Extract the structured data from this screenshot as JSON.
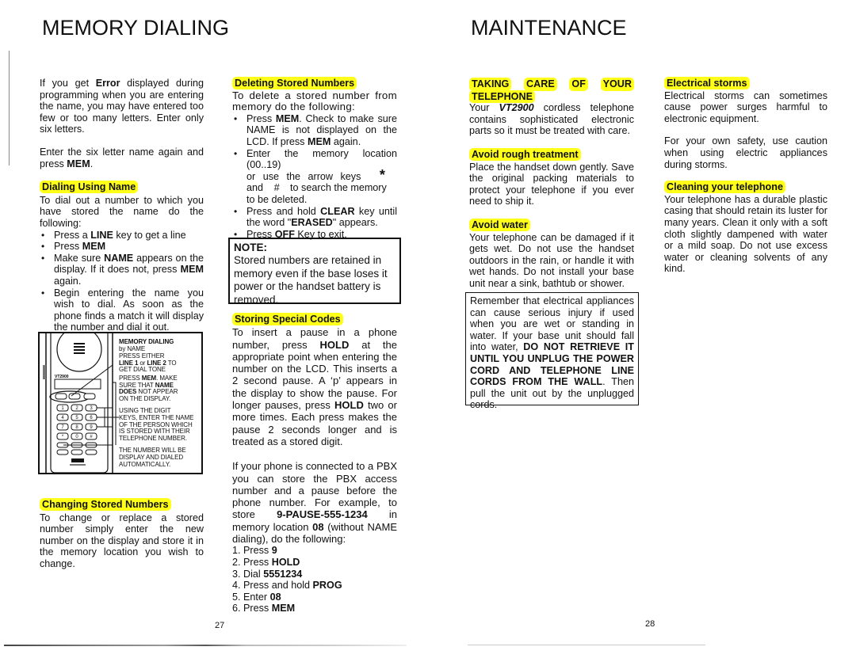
{
  "left_page": {
    "title": "MEMORY DIALING",
    "page_number": "27",
    "intro": {
      "p1_before": "If you get ",
      "p1_bold": "Error",
      "p1_after": " displayed during programming when you are entering the name, you may have entered  too few or too many letters.  Enter only six letters.",
      "p2_before": "Enter the six letter name again and press ",
      "p2_bold": "MEM",
      "p2_after": "."
    },
    "dialing_using_name": {
      "heading": "Dialing Using Name",
      "intro": "To dial out a number to which you have stored the name do the following:",
      "bullets": [
        {
          "before": "Press a ",
          "bold": "LINE",
          "after": " key to get a line"
        },
        {
          "before": "Press ",
          "bold": "MEM",
          "after": ""
        },
        {
          "before": "Make sure ",
          "bold": "NAME",
          "after": " appears on the display.  If it does not, press ",
          "bold2": "MEM",
          "after2": " again."
        },
        {
          "before": "Begin entering the name you wish to dial.  As soon as the phone finds a match it will display the number and dial it out.",
          "bold": "",
          "after": ""
        }
      ]
    },
    "figure": {
      "title": "MEMORY DIALING",
      "subtitle": "by NAME",
      "step1_a": "PRESS EITHER",
      "step1_b_bold1": "LINE 1",
      "step1_b_mid": " or ",
      "step1_b_bold2": "LINE 2",
      "step1_b_end": " TO",
      "step1_c": "GET DIAL TONE",
      "step2_a_pre": "PRESS ",
      "step2_a_bold": "MEM",
      "step2_a_post": ".  MAKE",
      "step2_b_pre": "SURE THAT ",
      "step2_b_bold": "NAME",
      "step2_c_bold": "DOES",
      "step2_c_post": " NOT APPEAR",
      "step2_d": "ON THE DISPLAY.",
      "step3_lines": [
        "USING THE DIGIT",
        "KEYS, ENTER THE NAME",
        "OF THE PERSON WHICH",
        "IS STORED WITH THEIR",
        "TELEPHONE NUMBER."
      ],
      "step4_lines": [
        "THE NUMBER WILL BE",
        "DISPLAY AND DIALED",
        "AUTOMATICALLY."
      ],
      "handset_model": "VT2900",
      "keypad": [
        "1",
        "2",
        "3",
        "4",
        "5",
        "6",
        "7",
        "8",
        "9",
        "*",
        "0",
        "#"
      ]
    },
    "changing_stored_numbers": {
      "heading": "Changing Stored Numbers",
      "body": "To change or replace a stored number simply enter the new number on the display and store it in the memory location you wish to change."
    },
    "deleting_stored_numbers": {
      "heading": "Deleting Stored Numbers",
      "intro": "To delete a stored number from memory do the following:",
      "b1_pre": "Press ",
      "b1_bold1": "MEM",
      "b1_mid": ". Check to make sure NAME is not displayed on the LCD. If press ",
      "b1_bold2": "MEM",
      "b1_post": " again.",
      "b2_line1": "Enter the memory location (00..19)",
      "b2_line2_pre": "or use the arrow keys",
      "b2_star": "*",
      "b2_line3_pre": "and",
      "b2_hash": "#",
      "b2_line3_post": "to search the memory",
      "b2_line4": "to be deleted.",
      "b3_pre": "Press and hold ",
      "b3_bold": "CLEAR",
      "b3_mid": " key until the word \"",
      "b3_bold2": "ERASED",
      "b3_post": "\" appears.",
      "b4_pre": "Press ",
      "b4_bold": "OFF",
      "b4_post": " Key to exit."
    },
    "note": {
      "label": "NOTE:",
      "body": "Stored numbers are retained in memory even if the base loses it power or the handset battery is removed."
    },
    "storing_special_codes": {
      "heading": "Storing Special Codes",
      "p1_a": "To insert a pause in a phone number, press ",
      "p1_bold1": "HOLD",
      "p1_b": " at the appropriate point when entering the number on the LCD. This inserts a 2 second pause. A ‘p’ appears in the display to show the pause.  For longer pauses, press ",
      "p1_bold2": "HOLD",
      "p1_c": " two or more times.  Each press makes the pause 2 seconds longer and is treated as a stored digit.",
      "p2_a": "If your phone is connected to a PBX you can store the PBX access number and a pause before the phone number. For example, to store ",
      "p2_bold1": "9-PAUSE-555-1234",
      "p2_b": " in memory location ",
      "p2_bold2": "08",
      "p2_c": " (without NAME dialing), do the following:",
      "steps": [
        {
          "n": "1.",
          "pre": "Press ",
          "bold": "9"
        },
        {
          "n": "2.",
          "pre": "Press ",
          "bold": "HOLD"
        },
        {
          "n": "3.",
          "pre": "Dial ",
          "bold": "5551234"
        },
        {
          "n": "4.",
          "pre": "Press and hold ",
          "bold": "PROG"
        },
        {
          "n": "5.",
          "pre": "Enter ",
          "bold": "08"
        },
        {
          "n": "6.",
          "pre": "Press ",
          "bold": "MEM"
        }
      ]
    }
  },
  "right_page": {
    "title": "MAINTENANCE",
    "page_number": "28",
    "taking_care": {
      "heading_words": [
        "TAKING",
        "CARE",
        "OF",
        "YOUR"
      ],
      "heading_line2": "TELEPHONE",
      "body_pre": "Your ",
      "body_model": "VT2900",
      "body_post": " cordless telephone contains sophisticated electronic parts so it must be treated with care."
    },
    "avoid_rough": {
      "heading": "Avoid rough treatment",
      "body": "Place the handset down gently.  Save the original packing materials to protect your telephone if you ever need to ship it."
    },
    "avoid_water": {
      "heading": "Avoid water",
      "body": "Your telephone can be damaged if it gets wet.  Do not use the handset outdoors in the rain, or handle it with wet hands.  Do not install your base unit near a sink, bathtub or shower."
    },
    "warning_box": {
      "pre": "Remember that electrical appliances can cause serious injury if used when you are wet or standing in water.   If your base unit should fall into water, ",
      "bold": "DO NOT RETRIEVE IT UNTIL YOU UNPLUG THE POWER CORD AND TELEPHONE LINE CORDS FROM THE WALL",
      "post": ".  Then pull the unit out by the unplugged cords."
    },
    "electrical_storms": {
      "heading": "Electrical storms",
      "p1": "Electrical storms can sometimes cause power surges harmful to electronic equipment.",
      "p2": "For your own safety, use caution when using electric appliances during storms."
    },
    "cleaning": {
      "heading": "Cleaning your telephone",
      "body": "Your telephone has a durable plastic casing that should retain its luster for many years.  Clean it only with a soft cloth slightly dampened with water or a mild soap.  Do not use excess water or cleaning solvents of any kind."
    }
  },
  "colors": {
    "highlight": "#ffff1a",
    "text": "#111111"
  }
}
